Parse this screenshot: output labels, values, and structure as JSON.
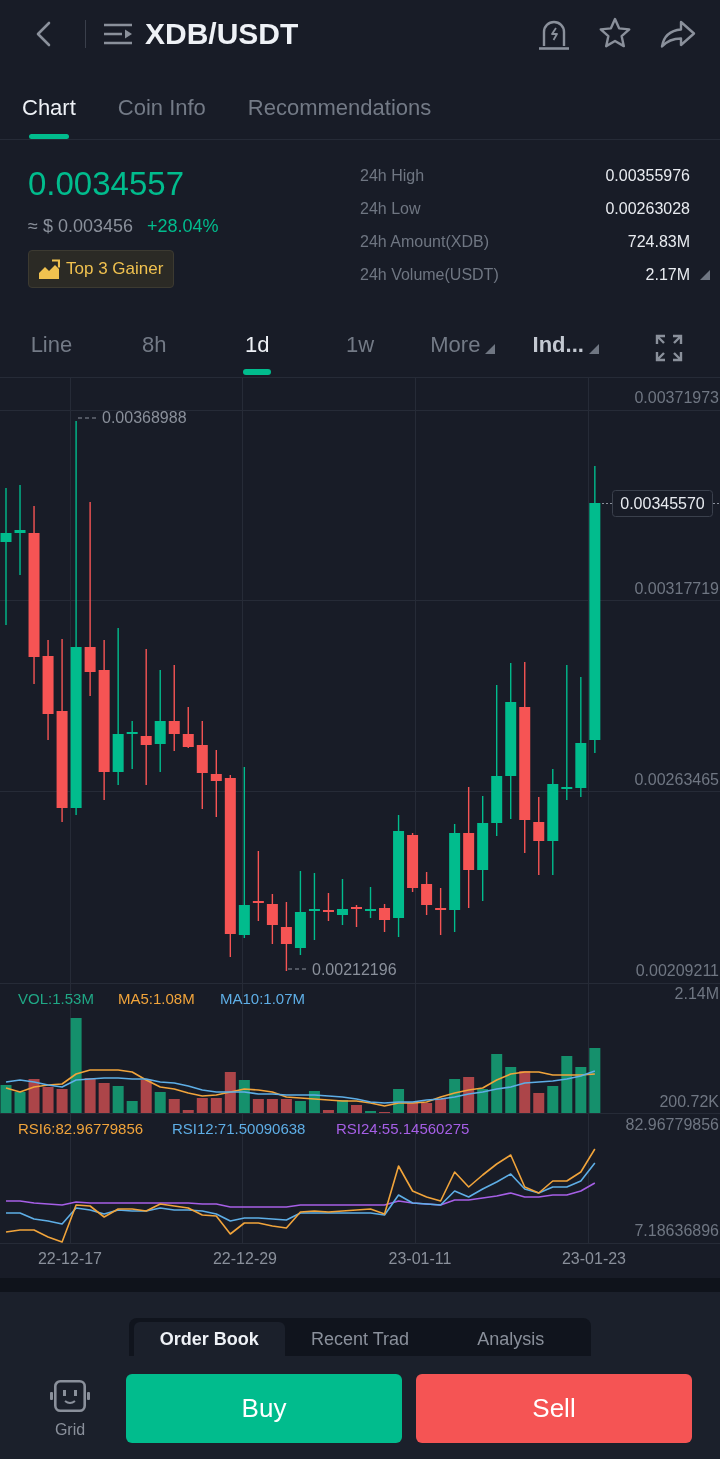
{
  "header": {
    "title": "XDB/USDT",
    "favorite": false
  },
  "tabs": [
    {
      "label": "Chart",
      "selected": true
    },
    {
      "label": "Coin Info",
      "selected": false
    },
    {
      "label": "Recommendations",
      "selected": false
    }
  ],
  "ticker": {
    "price": "0.0034557",
    "fiat_price": "≈ $ 0.003456",
    "change": "+28.04%",
    "badge": "Top 3 Gainer",
    "stats": [
      {
        "label": "24h High",
        "value": "0.00355976",
        "dropdown": false
      },
      {
        "label": "24h Low",
        "value": "0.00263028",
        "dropdown": false
      },
      {
        "label": "24h Amount(XDB)",
        "value": "724.83M",
        "dropdown": false
      },
      {
        "label": "24h Volume(USDT)",
        "value": "2.17M",
        "dropdown": true
      }
    ]
  },
  "intervals": [
    {
      "label": "Line",
      "kind": "option",
      "selected": false,
      "active": false
    },
    {
      "label": "8h",
      "kind": "option",
      "selected": false,
      "active": false
    },
    {
      "label": "1d",
      "kind": "option",
      "selected": true,
      "active": false
    },
    {
      "label": "1w",
      "kind": "option",
      "selected": false,
      "active": false
    },
    {
      "label": "More",
      "kind": "menu",
      "selected": false,
      "active": false
    },
    {
      "label": "Ind...",
      "kind": "menu",
      "selected": false,
      "active": true
    }
  ],
  "chart": {
    "price_axis": [
      "0.00371973",
      "0.00317719",
      "0.00263465",
      "0.00209211"
    ],
    "high_label": "0.00368988",
    "low_label": "0.00212196",
    "last_price": "0.00345570",
    "volume_legend": [
      {
        "label": "VOL:1.53M",
        "color": "#20a886"
      },
      {
        "label": "MA5:1.08M",
        "color": "#f1a43b"
      },
      {
        "label": "MA10:1.07M",
        "color": "#5eaee6"
      }
    ],
    "volume_axis": [
      "2.14M",
      "200.72K"
    ],
    "rsi_legend": [
      {
        "label": "RSI6:82.96779856",
        "color": "#f1a43b"
      },
      {
        "label": "RSI12:71.50090638",
        "color": "#5eaee6"
      },
      {
        "label": "RSI24:55.14560275",
        "color": "#a65fe6"
      }
    ],
    "rsi_axis": [
      "82.96779856",
      "7.18636896"
    ],
    "dates": [
      "22-12-17",
      "22-12-29",
      "23-01-11",
      "23-01-23"
    ]
  },
  "sheet_tabs": [
    {
      "label": "Order Book",
      "selected": true
    },
    {
      "label": "Recent Trad",
      "selected": false
    },
    {
      "label": "Analysis",
      "selected": false
    }
  ],
  "actions": {
    "grid": "Grid",
    "buy": "Buy",
    "sell": "Sell"
  }
}
